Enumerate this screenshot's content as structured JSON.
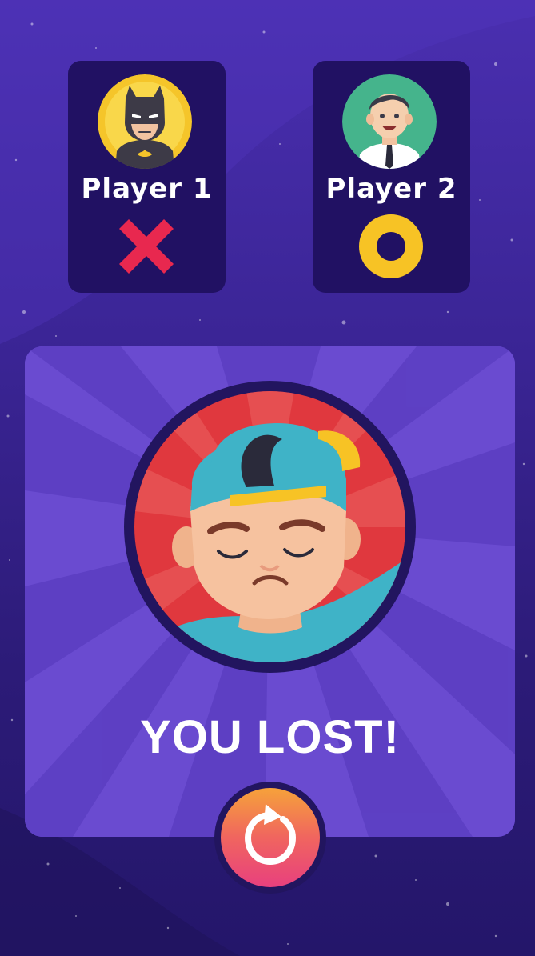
{
  "players": [
    {
      "name": "Player 1",
      "avatar_icon": "batman-avatar-icon",
      "mark_icon": "x-mark-icon",
      "mark_color": "#e8284f"
    },
    {
      "name": "Player 2",
      "avatar_icon": "businessman-avatar-icon",
      "mark_icon": "o-mark-icon",
      "mark_color": "#f7c325"
    }
  ],
  "result": {
    "text": "YOU LOST!",
    "illustration_icon": "sad-boy-cap-icon"
  },
  "actions": {
    "replay_icon": "replay-icon"
  },
  "colors": {
    "background": "#3b2596",
    "card": "#211163",
    "panel": "#6a4bd0",
    "accent_x": "#e8284f",
    "accent_o": "#f7c325"
  }
}
